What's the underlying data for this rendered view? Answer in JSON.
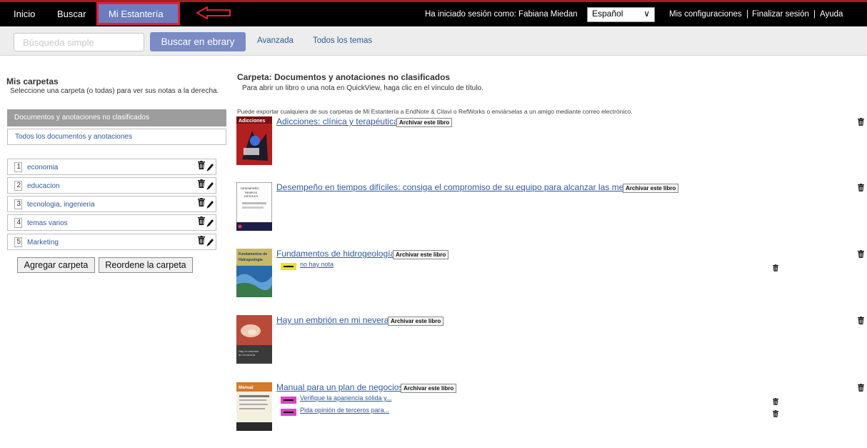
{
  "topnav": {
    "inicio": "Inicio",
    "buscar": "Buscar",
    "estanteria": "Mi Estantería",
    "login_label": "Ha iniciado sesión como:",
    "user": "Fabiana Miedan",
    "language": "Español",
    "configuraciones": "Mis configuraciones",
    "finalizar": "Finalizar sesión",
    "ayuda": "Ayuda",
    "separator": "|"
  },
  "search": {
    "placeholder": "Búsqueda simple",
    "button": "Buscar en ebrary",
    "advanced": "Avanzada",
    "all_topics": "Todos los temas"
  },
  "left": {
    "title": "Mis carpetas",
    "subtitle": "Seleccione una carpeta (o todas) para ver sus notas a la derecha.",
    "unclassified": "Documentos y anotaciones no clasificados",
    "all": "Todos los documentos y anotaciones",
    "folders": [
      {
        "num": "1",
        "name": "economia"
      },
      {
        "num": "2",
        "name": "educacion"
      },
      {
        "num": "3",
        "name": "tecnologia, ingenieria"
      },
      {
        "num": "4",
        "name": "temas varios"
      },
      {
        "num": "5",
        "name": "Marketing"
      }
    ],
    "add_button": "Agregar carpeta",
    "reorder_button": "Reordene la carpeta"
  },
  "main": {
    "title": "Carpeta: Documentos y anotaciones no clasificados",
    "subtitle": "Para abrir un libro o una nota en QuickView, haga clic en el vínculo de título.",
    "export_text": "Puede exportar cualquiera de sus carpetas de Mi Estantería a EndNote & Citavi o RefWorks o enviárselas a un amigo mediante correo electrónico.",
    "archive_label": "Archivar este libro",
    "books": [
      {
        "title": "Adicciones: clínica y terapéutica",
        "cover_text": "Adicciones"
      },
      {
        "title": "Desempeño en tiempos difíciles: consiga el compromiso de su equipo para alcanzar las metas",
        "cover_text": "DESEMPEÑO EN TIEMPOS DIFÍCILES"
      },
      {
        "title": "Fundamentos de hidrogeología",
        "cover_text": "Fundamentos de Hidrogeología",
        "notes": [
          {
            "text": "no hay nota",
            "color": "#f0e020"
          }
        ]
      },
      {
        "title": "Hay un embrión en mi nevera",
        "cover_text": "Hay un embrión en mi nevera"
      },
      {
        "title": "Manual para un plan de negocios",
        "cover_text": "Manual",
        "notes": [
          {
            "text": "Verifique la apariencia sólida y...",
            "color": "#e040c0"
          },
          {
            "text": "Pida opinión de terceros para...",
            "color": "#e040c0"
          }
        ]
      }
    ]
  },
  "colors": {
    "nav_bg": "#000000",
    "active_tab": "#6b7dbf",
    "highlight_border": "#e2203a",
    "link": "#2c5aa0",
    "search_button": "#7a8bc6"
  }
}
